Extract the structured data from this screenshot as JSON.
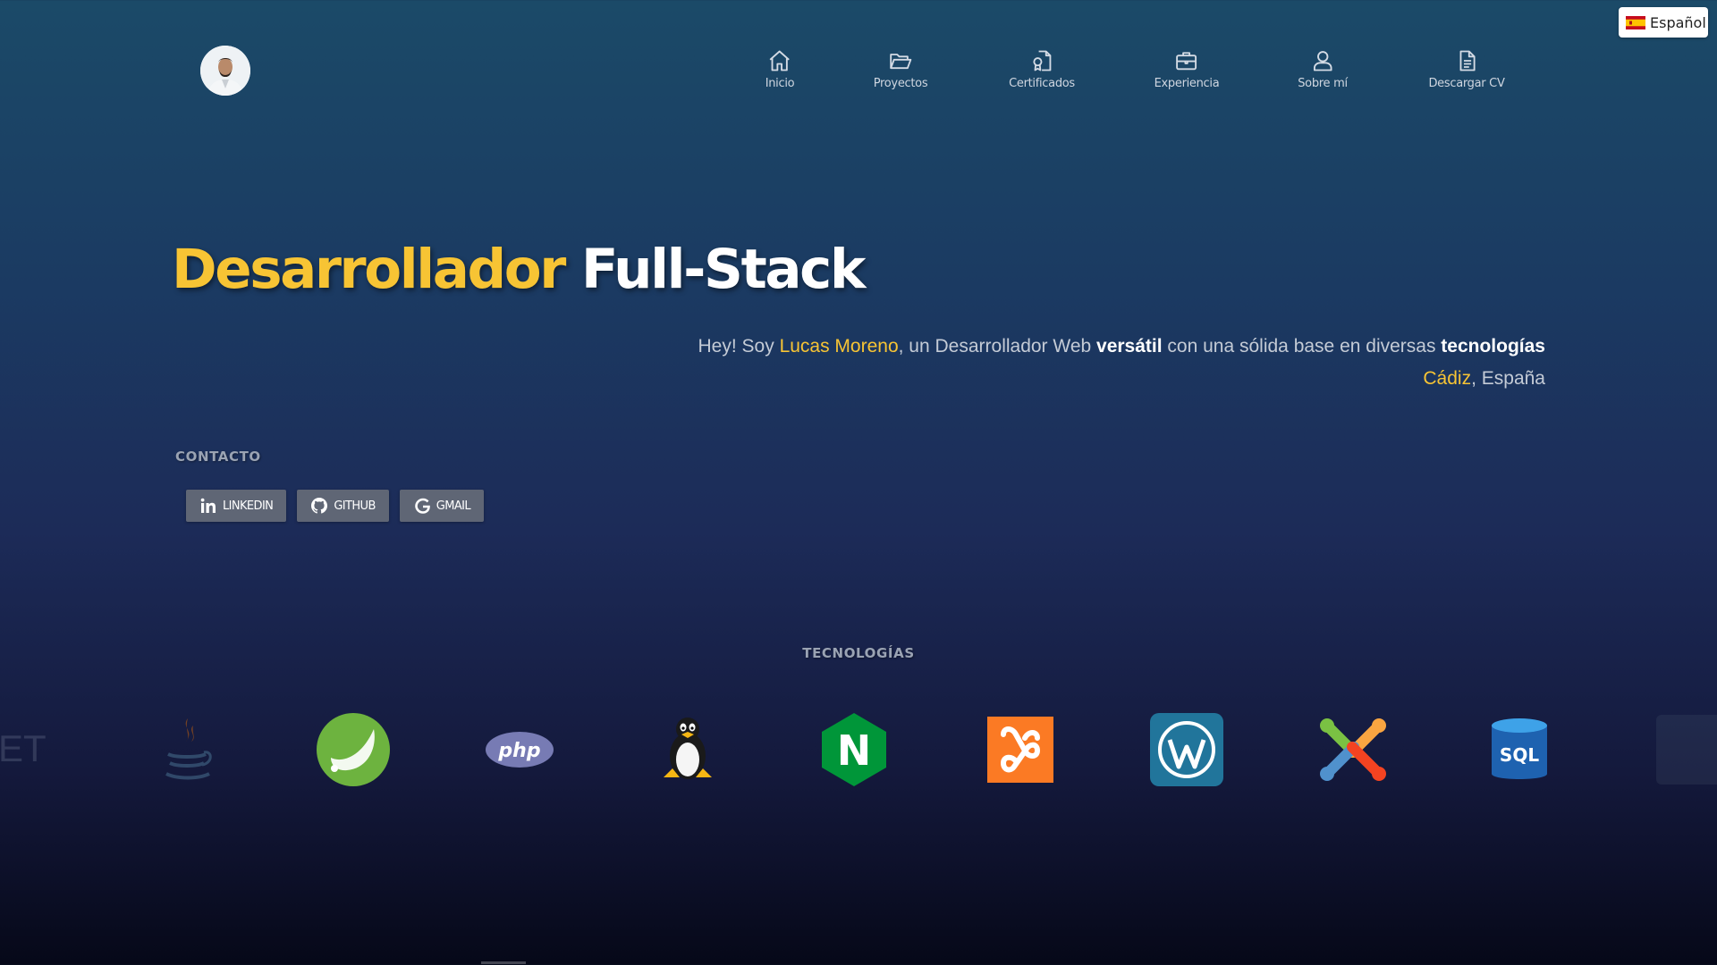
{
  "language_switch": {
    "label": "Español",
    "icon": "spain-flag-icon"
  },
  "nav": [
    {
      "label": "Inicio",
      "icon": "home-icon"
    },
    {
      "label": "Proyectos",
      "icon": "folder-open-icon"
    },
    {
      "label": "Certificados",
      "icon": "certificate-icon"
    },
    {
      "label": "Experiencia",
      "icon": "briefcase-icon"
    },
    {
      "label": "Sobre mí",
      "icon": "user-icon"
    },
    {
      "label": "Descargar CV",
      "icon": "document-icon"
    }
  ],
  "hero": {
    "title_highlight": "Desarrollador",
    "title_rest": "Full-Stack",
    "intro": {
      "prefix": "Hey! Soy ",
      "name": "Lucas Moreno",
      "middle": ", un Desarrollador Web ",
      "adjective": "versátil",
      "middle2": " con una sólida base en diversas ",
      "techword": "tecnologías",
      "city": "Cádiz",
      "country": ", España"
    }
  },
  "contact": {
    "label": "CONTACTO",
    "buttons": [
      {
        "label": "LINKEDIN",
        "icon": "linkedin-icon"
      },
      {
        "label": "GITHUB",
        "icon": "github-icon"
      },
      {
        "label": "GMAIL",
        "icon": "google-icon"
      }
    ]
  },
  "technologies": {
    "label": "TECNOLOGÍAS",
    "logos": [
      {
        "name": "dotnet",
        "text": "ET"
      },
      {
        "name": "java"
      },
      {
        "name": "spring"
      },
      {
        "name": "php",
        "text": "php"
      },
      {
        "name": "linux"
      },
      {
        "name": "nginx",
        "text": "N"
      },
      {
        "name": "xampp"
      },
      {
        "name": "wordpress"
      },
      {
        "name": "joomla"
      },
      {
        "name": "sql",
        "text": "SQL"
      },
      {
        "name": "partial"
      }
    ]
  },
  "colors": {
    "accent_yellow": "#f7c434",
    "button_gray": "#5f6675",
    "bg_top": "#1b4a68",
    "bg_bottom": "#060818"
  }
}
